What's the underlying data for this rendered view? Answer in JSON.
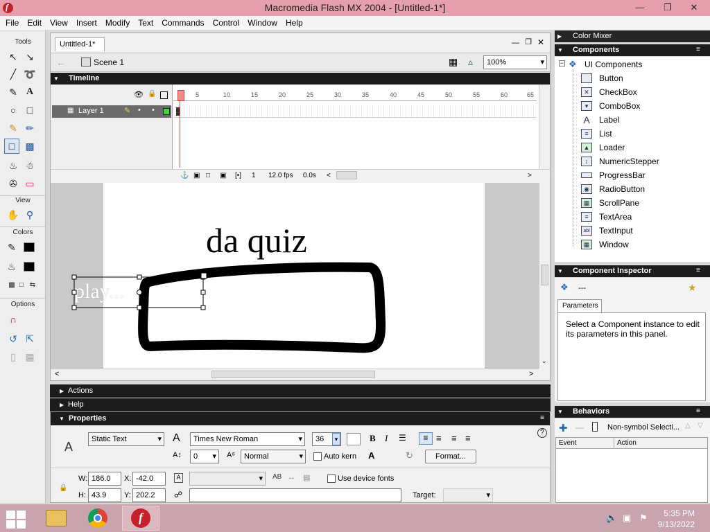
{
  "window": {
    "title": "Macromedia Flash MX 2004 - [Untitled-1*]"
  },
  "menu": [
    "File",
    "Edit",
    "View",
    "Insert",
    "Modify",
    "Text",
    "Commands",
    "Control",
    "Window",
    "Help"
  ],
  "tools": {
    "label": "Tools",
    "view_label": "View",
    "colors_label": "Colors",
    "options_label": "Options"
  },
  "document": {
    "tab": "Untitled-1*",
    "scene": "Scene 1",
    "zoom": "100%"
  },
  "timeline": {
    "title": "Timeline",
    "layer": "Layer 1",
    "ruler": [
      "5",
      "10",
      "15",
      "20",
      "25",
      "30",
      "35",
      "40",
      "45",
      "50",
      "55",
      "60",
      "65"
    ],
    "frame": "1",
    "fps": "12.0 fps",
    "time": "0.0s"
  },
  "stage": {
    "headline": "da quiz",
    "ghost_text": "play..."
  },
  "panels": {
    "actions": "Actions",
    "help": "Help",
    "properties": "Properties"
  },
  "properties": {
    "text_type": "Static Text",
    "font": "Times New Roman",
    "size": "36",
    "tracking": "0",
    "character_position": "Normal",
    "auto_kern": "Auto kern",
    "format_button": "Format...",
    "w_label": "W:",
    "w": "186.0",
    "x_label": "X:",
    "x": "-42.0",
    "h_label": "H:",
    "h": "43.9",
    "y_label": "Y:",
    "y": "202.2",
    "device_fonts": "Use device fonts",
    "target_label": "Target:"
  },
  "right": {
    "color_mixer": "Color Mixer",
    "components": "Components",
    "ui_components": "UI Components",
    "component_items": [
      "Button",
      "CheckBox",
      "ComboBox",
      "Label",
      "List",
      "Loader",
      "NumericStepper",
      "ProgressBar",
      "RadioButton",
      "ScrollPane",
      "TextArea",
      "TextInput",
      "Window"
    ],
    "inspector": "Component Inspector",
    "inspector_value": "---",
    "parameters_tab": "Parameters",
    "inspector_message": "Select a Component instance to edit its parameters in this panel.",
    "behaviors": "Behaviors",
    "behaviors_selection": "Non-symbol Selecti...",
    "event_col": "Event",
    "action_col": "Action"
  },
  "taskbar": {
    "time": "5:35 PM",
    "date": "9/13/2022"
  },
  "colors": {
    "titlebar": "#e6a0ad",
    "panel_header": "#1c1c1c",
    "taskbar": "#c9a3ad",
    "flash_red": "#c8202a"
  }
}
